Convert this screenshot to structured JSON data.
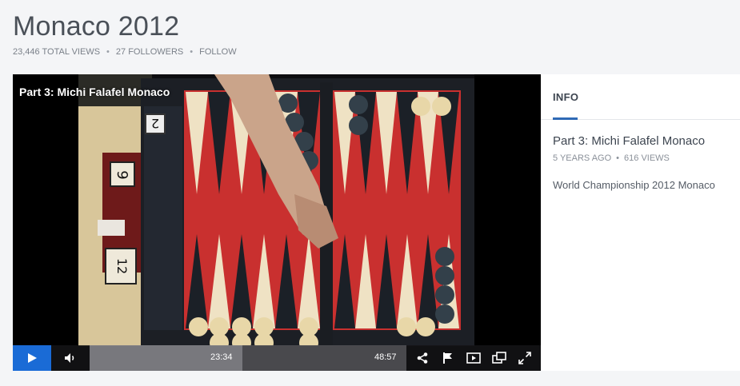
{
  "channel": {
    "title": "Monaco 2012",
    "total_views": "23,446 TOTAL VIEWS",
    "followers": "27 FOLLOWERS",
    "follow_label": "FOLLOW",
    "separator": "•"
  },
  "player": {
    "overlay_title": "Part 3: Michi Falafel Monaco",
    "time_current": "23:34",
    "time_total": "48:57",
    "progress_fraction": 0.482,
    "accent_color": "#1a6bd6",
    "icons": [
      "play-icon",
      "volume-icon",
      "share-icon",
      "flag-icon",
      "embed-icon",
      "popout-icon",
      "fullscreen-icon"
    ]
  },
  "info": {
    "tab_label": "INFO",
    "video_title": "Part 3: Michi Falafel Monaco",
    "age": "5 YEARS AGO",
    "views": "616 VIEWS",
    "description": "World Championship 2012 Monaco",
    "accent_color": "#2f6ab5"
  }
}
